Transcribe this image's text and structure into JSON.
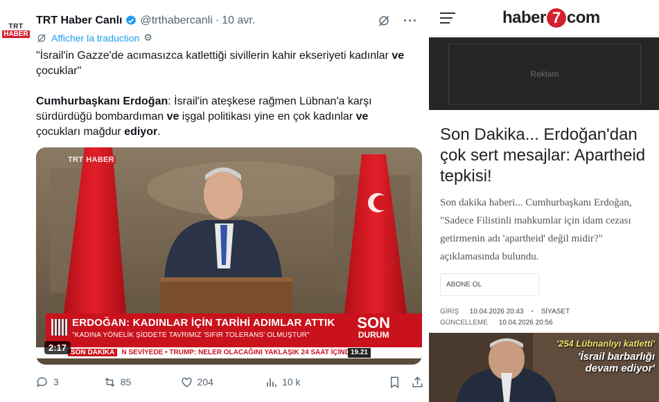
{
  "tweet": {
    "avatar_top": "TRT",
    "avatar_bottom": "HABER",
    "name": "TRT Haber Canlı",
    "handle": "@trthabercanli",
    "date": "10 avr.",
    "translate_label": "Afficher la traduction",
    "quote": "\"İsrail'in Gazze'de acımasızca katlettiği sivillerin kahir ekseriyeti kadınlar",
    "quote_bold": "ve",
    "quote_end": "çocuklar\"",
    "p2_bold1": "Cumhurbaşkanı Erdoğan",
    "p2_text1": ": İsrail'in ateşkese rağmen Lübnan'a karşı sürdürdüğü bombardıman ",
    "p2_bold2": "ve",
    "p2_text2": " işgal politikası yine en çok kadınlar ",
    "p2_bold3": "ve",
    "p2_text3": " çocukları mağdur ",
    "p2_bold4": "ediyor",
    "p2_end": ".",
    "video": {
      "channel_logo_a": "TRT",
      "channel_logo_b": "HABER",
      "headline": "ERDOĞAN: KADINLAR İÇİN TARİHİ ADIMLAR ATTIK",
      "subline": "\"KADINA YÖNELİK ŞİDDETE TAVRIMIZ 'SIFIR TOLERANS' OLMUŞTUR\"",
      "son": "SON",
      "durum": "DURUM",
      "ticker_label": "SON DAKİKA",
      "ticker_text": "N SEVİYEDE  •  TRUMP: NELER OLACAĞINI YAKLAŞIK 24 SAAT İÇİNDE",
      "ticker_time": "19.21",
      "duration": "2:17"
    },
    "stats": {
      "replies": "3",
      "retweets": "85",
      "likes": "204",
      "views": "10 k"
    }
  },
  "news": {
    "site_logo_left": "haber",
    "site_logo_seven": "7",
    "site_logo_right": "com",
    "ad_label": "Reklam",
    "title": "Son Dakika... Erdoğan'dan çok sert mesajlar: Apartheid tepkisi!",
    "lead": "Son dakika haberi... Cumhurbaşkanı Erdoğan, \"Sadece Filistinli mahkumlar için idam cezası getirmenin adı 'apartheid' değil midir?\" açıklamasında bulundu.",
    "subscribe_label": "ABONE OL",
    "entry_label": "GİRİŞ",
    "entry_time": "10.04.2026 20:43",
    "category": "SİYASET",
    "update_label": "GÜNCELLEME",
    "update_time": "10.04.2026 20:56",
    "image_caption1": "'254 Lübnanlıyı katletti'",
    "image_caption2a": "'İsrail barbarlığı",
    "image_caption2b": "devam ediyor'"
  },
  "colors": {
    "twitter_blue": "#1d9bf0",
    "trt_red": "#d3202d",
    "ad_background": "#262626"
  },
  "icons": [
    "verified-badge-icon",
    "grok-icon",
    "more-icon",
    "translate-icon",
    "gear-icon",
    "reply-icon",
    "retweet-icon",
    "like-icon",
    "views-icon",
    "bookmark-icon",
    "share-icon",
    "hamburger-menu-icon"
  ]
}
